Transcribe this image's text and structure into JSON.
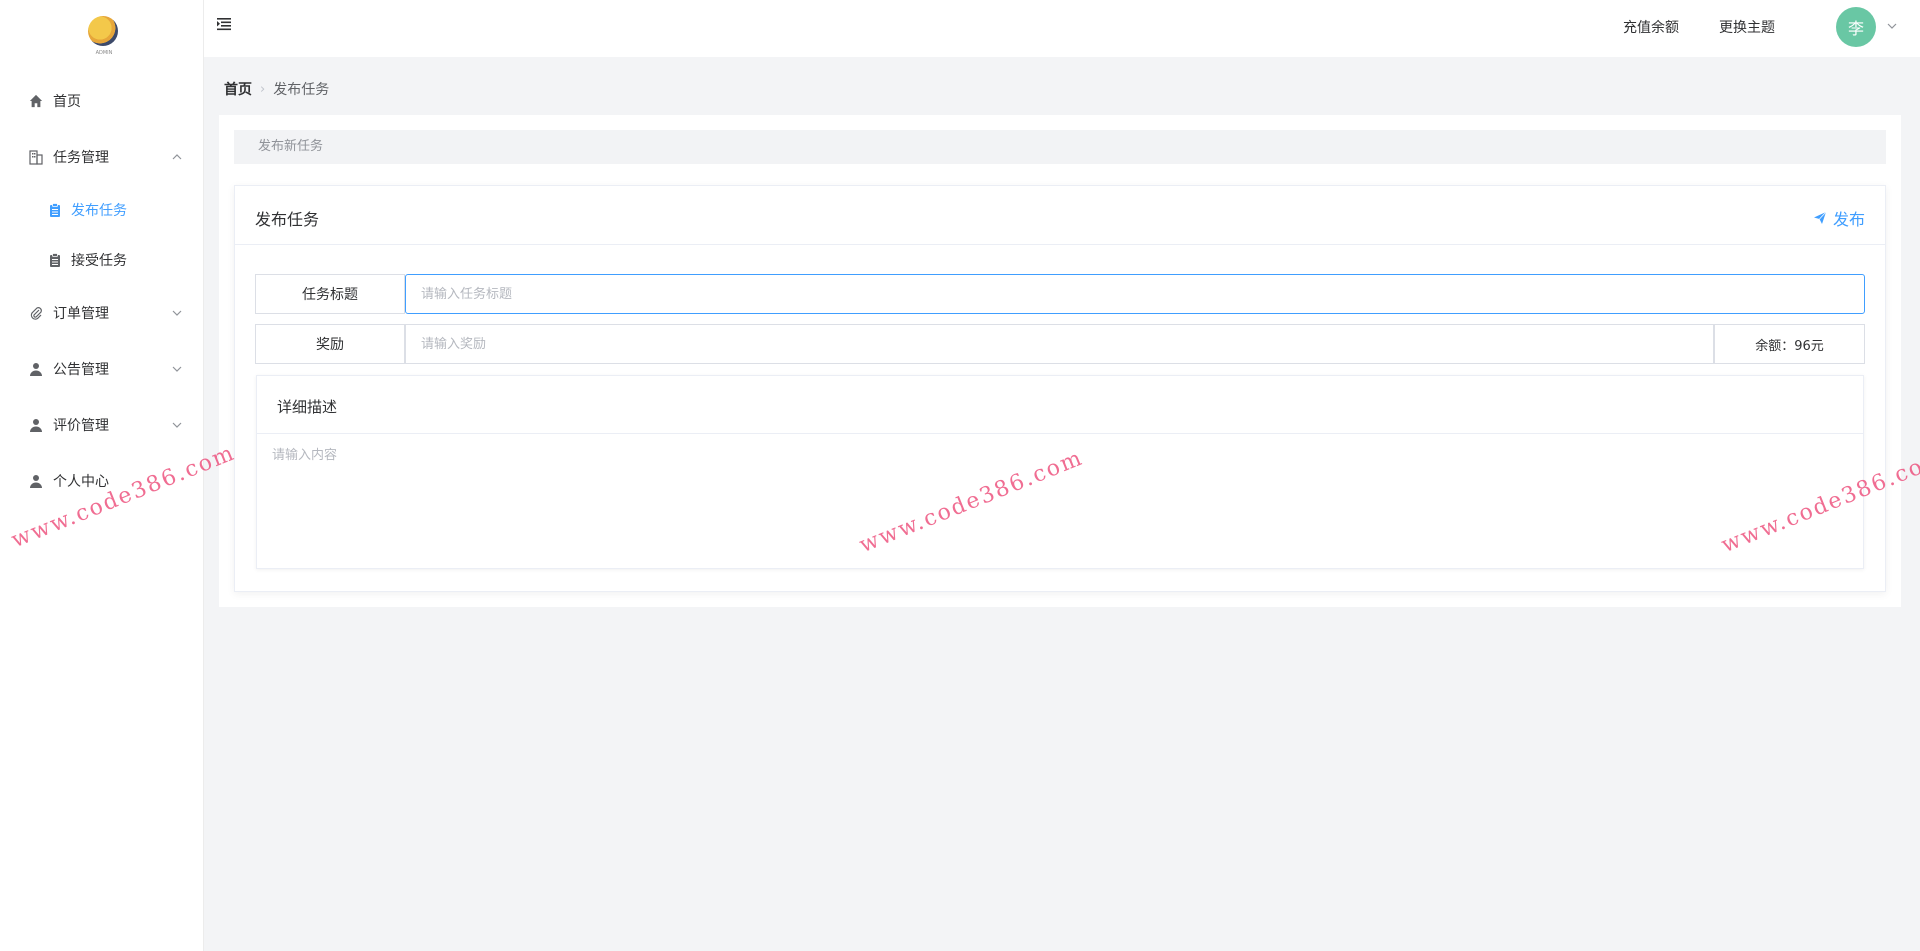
{
  "sidebar": {
    "logo_text": "ADMIN",
    "items": [
      {
        "label": "首页",
        "icon": "home-icon"
      },
      {
        "label": "任务管理",
        "icon": "building-icon",
        "expanded": true,
        "children": [
          {
            "label": "发布任务",
            "icon": "clipboard-icon",
            "active": true
          },
          {
            "label": "接受任务",
            "icon": "clipboard-icon",
            "active": false
          }
        ]
      },
      {
        "label": "订单管理",
        "icon": "paperclip-icon",
        "expanded": false
      },
      {
        "label": "公告管理",
        "icon": "user-icon",
        "expanded": false
      },
      {
        "label": "评价管理",
        "icon": "user-icon",
        "expanded": false
      },
      {
        "label": "个人中心",
        "icon": "user-icon"
      }
    ]
  },
  "header": {
    "recharge_label": "充值余额",
    "theme_label": "更换主题",
    "avatar_text": "李",
    "avatar_color": "#69c7a4"
  },
  "breadcrumb": {
    "home": "首页",
    "current": "发布任务"
  },
  "main": {
    "section_title": "发布新任务",
    "panel": {
      "title": "发布任务",
      "publish_label": "发布",
      "title_field": {
        "label": "任务标题",
        "placeholder": "请输入任务标题",
        "value": ""
      },
      "reward_field": {
        "label": "奖励",
        "placeholder": "请输入奖励",
        "value": "",
        "balance_text": "余额：96元"
      },
      "description": {
        "label": "详细描述",
        "placeholder": "请输入内容",
        "value": ""
      }
    }
  },
  "watermark": {
    "text": "www.code386.com"
  },
  "colors": {
    "accent": "#409eff",
    "watermark": "#eb3c6e"
  }
}
